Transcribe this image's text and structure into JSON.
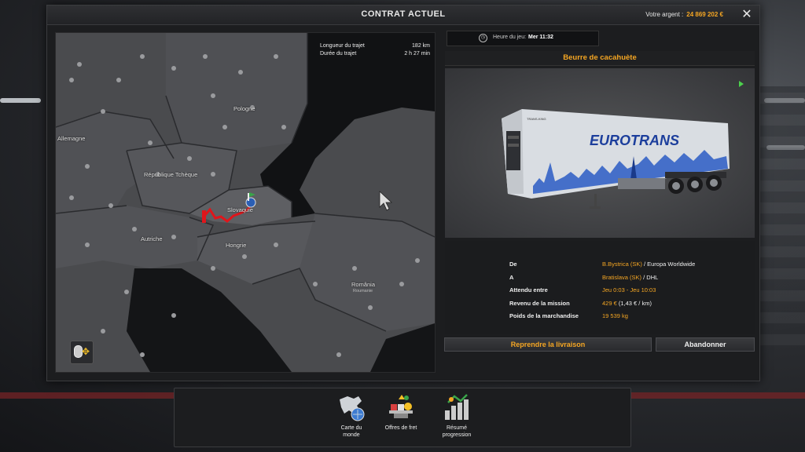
{
  "window": {
    "title": "CONTRAT ACTUEL",
    "money_label": "Votre argent :",
    "money_value": "24 869 202 €",
    "close_symbol": "✕"
  },
  "map": {
    "route_info": {
      "length_label": "Longueur du trajet",
      "length_value": "182 km",
      "duration_label": "Durée du trajet",
      "duration_value": "2 h 27 min"
    },
    "countries": [
      {
        "name": "Allemagne"
      },
      {
        "name": "Pologne"
      },
      {
        "name": "République Tchèque"
      },
      {
        "name": "Slovaquie"
      },
      {
        "name": "Autriche"
      },
      {
        "name": "Hongrie"
      },
      {
        "name": "România"
      }
    ],
    "sublabel": "Roumanie"
  },
  "game_time": {
    "label": "Heure du jeu:",
    "value": "Mer 11:32"
  },
  "cargo": {
    "name": "Beurre de cacahuète",
    "trailer_brand": "EUROTRANS",
    "trailer_small_text": "TRANS-KING"
  },
  "details": {
    "from_label": "De",
    "from_city": "B.Bystrica (SK)",
    "from_company": "/ Europa Worldwide",
    "to_label": "A",
    "to_city": "Bratislava (SK)",
    "to_company": "/ DHL",
    "expected_label": "Attendu entre",
    "expected_value": "Jeu 0:03 - Jeu 10:03",
    "revenue_label": "Revenu de la mission",
    "revenue_value": "429 €",
    "revenue_rate": "(1,43 € / km)",
    "weight_label": "Poids de la marchandise",
    "weight_value": "19 539 kg"
  },
  "buttons": {
    "resume": "Reprendre la livraison",
    "abandon": "Abandonner"
  },
  "dock": [
    {
      "label_1": "Carte du",
      "label_2": "monde",
      "icon": "world-map-icon"
    },
    {
      "label_1": "Offres de fret",
      "label_2": "",
      "icon": "freight-offers-icon"
    },
    {
      "label_1": "Résumé",
      "label_2": "progression",
      "icon": "progress-summary-icon"
    }
  ],
  "colors": {
    "accent": "#f5a623",
    "route": "#e0151b",
    "destination_flag": "#3aa54a"
  }
}
